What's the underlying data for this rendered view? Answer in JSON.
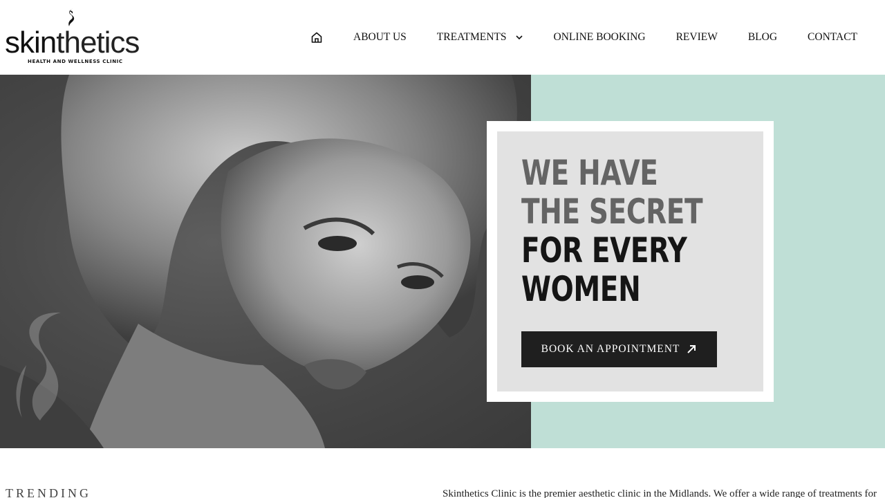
{
  "brand": {
    "wordmark_bold": "skin",
    "wordmark_light": "thetics",
    "tagline": "HEALTH AND WELLNESS CLINIC",
    "mark_icon": "skinthetics-s-logo-icon"
  },
  "nav": {
    "home_icon": "home-icon",
    "items": [
      {
        "label": "ABOUT US"
      },
      {
        "label": "TREATMENTS",
        "has_dropdown": true
      },
      {
        "label": "ONLINE BOOKING"
      },
      {
        "label": "REVIEW"
      },
      {
        "label": "BLOG"
      },
      {
        "label": "CONTACT"
      }
    ]
  },
  "hero": {
    "headline_line1": "WE HAVE",
    "headline_line2": "THE SECRET",
    "headline_line3": "FOR EVERY",
    "headline_line4": "WOMEN",
    "cta_label": "BOOK AN APPOINTMENT",
    "cta_icon": "arrow-up-right-icon",
    "panel_color": "#bfdfd6",
    "card_color": "#e2e2e2"
  },
  "below": {
    "section_label": "TRENDING",
    "intro_text": "Skinthetics Clinic is the premier aesthetic clinic in the Midlands. We offer a wide range of treatments for"
  }
}
